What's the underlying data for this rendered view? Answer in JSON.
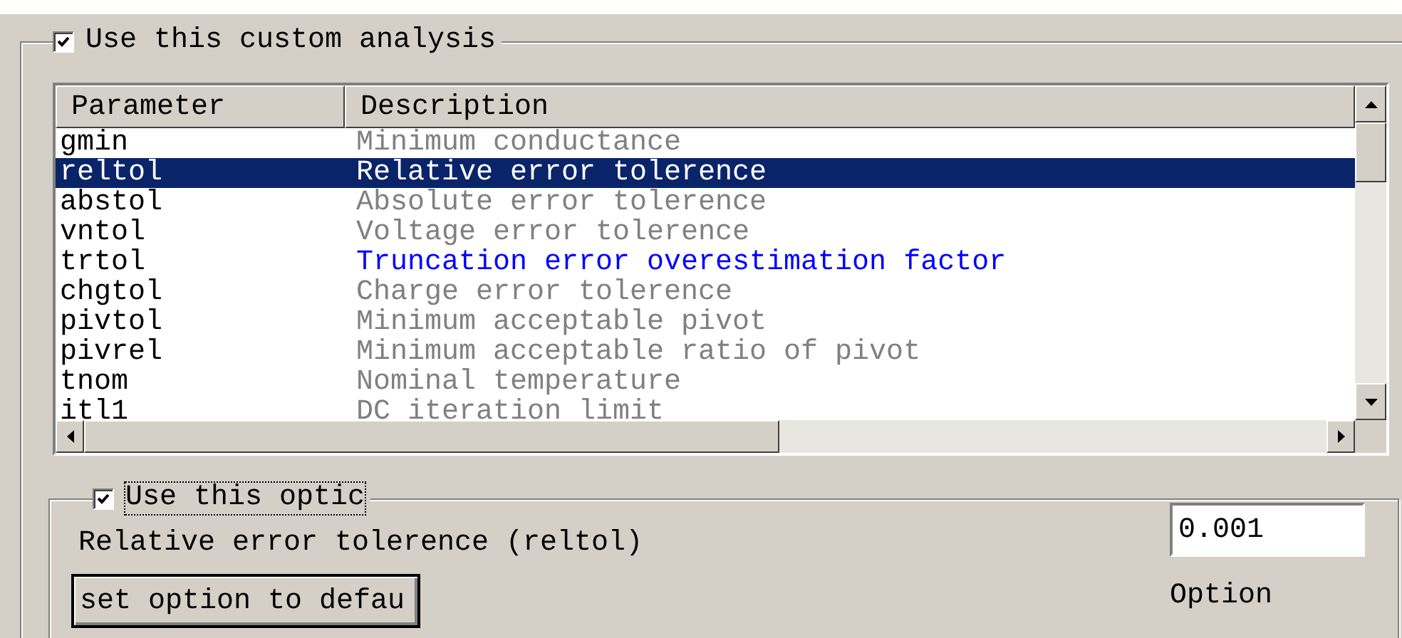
{
  "analysis": {
    "label": "Use this custom analysis",
    "checked": true
  },
  "table": {
    "columns": [
      "Parameter",
      "Description"
    ],
    "rows": [
      {
        "parameter": "gmin",
        "description": "Minimum conductance",
        "modified": false,
        "selected": false
      },
      {
        "parameter": "reltol",
        "description": "Relative error tolerence",
        "selected": true
      },
      {
        "parameter": "abstol",
        "description": "Absolute error tolerence",
        "modified": false,
        "selected": false
      },
      {
        "parameter": "vntol",
        "description": "Voltage error tolerence",
        "modified": false,
        "selected": false
      },
      {
        "parameter": "trtol",
        "description": "Truncation error overestimation factor",
        "modified": true,
        "selected": false
      },
      {
        "parameter": "chgtol",
        "description": "Charge error tolerence",
        "modified": false,
        "selected": false
      },
      {
        "parameter": "pivtol",
        "description": "Minimum acceptable pivot",
        "modified": false,
        "selected": false
      },
      {
        "parameter": "pivrel",
        "description": "Minimum acceptable ratio of pivot",
        "modified": false,
        "selected": false
      },
      {
        "parameter": "tnom",
        "description": "Nominal temperature",
        "modified": false,
        "selected": false
      },
      {
        "parameter": "itl1",
        "description": "DC iteration limit",
        "modified": false,
        "selected": false
      }
    ]
  },
  "option": {
    "label": "Use this optic",
    "checked": true,
    "name": "Relative error tolerence (reltol)",
    "value": "0.001",
    "reset_button": "set option to defau",
    "value_label": "Option"
  }
}
